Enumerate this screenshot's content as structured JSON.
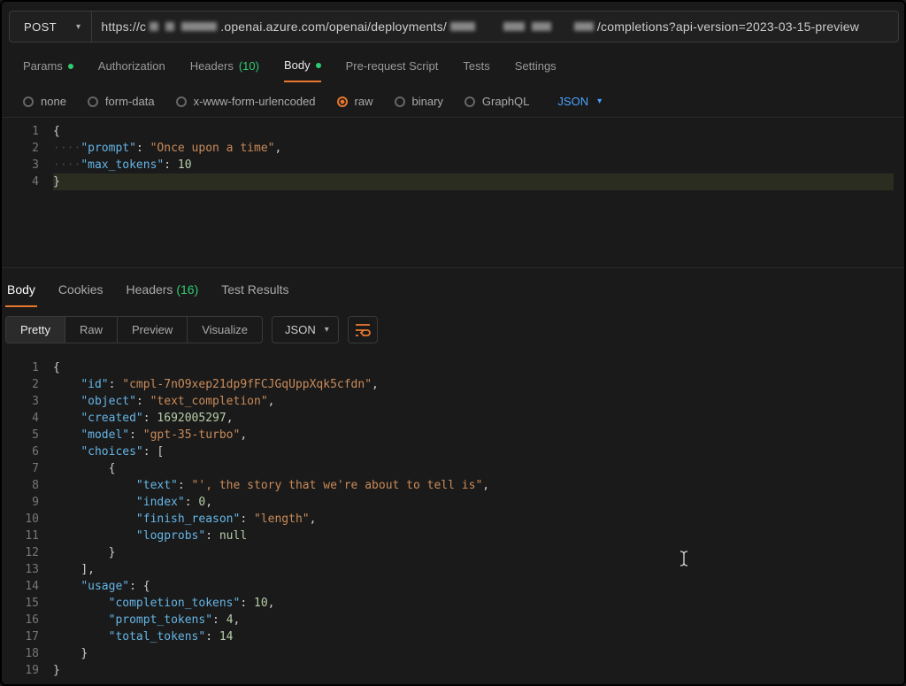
{
  "request": {
    "method": "POST",
    "url_prefix": "https://c",
    "url_mid": ".openai.azure.com/openai/deployments/",
    "url_suffix": "/completions?api-version=2023-03-15-preview"
  },
  "section_tabs": {
    "params": "Params",
    "authorization": "Authorization",
    "headers_label": "Headers",
    "headers_count": "(10)",
    "body": "Body",
    "prescript": "Pre-request Script",
    "tests": "Tests",
    "settings": "Settings"
  },
  "body_types": {
    "none": "none",
    "formdata": "form-data",
    "urlencoded": "x-www-form-urlencoded",
    "raw": "raw",
    "binary": "binary",
    "graphql": "GraphQL",
    "format": "JSON"
  },
  "request_body": {
    "line1": "{",
    "line2_key": "\"prompt\"",
    "line2_val": "\"Once upon a time\"",
    "line3_key": "\"max_tokens\"",
    "line3_val": "10",
    "line4": "}"
  },
  "response_tabs": {
    "body": "Body",
    "cookies": "Cookies",
    "headers_label": "Headers",
    "headers_count": "(16)",
    "testresults": "Test Results"
  },
  "response_toolbar": {
    "pretty": "Pretty",
    "raw": "Raw",
    "preview": "Preview",
    "visualize": "Visualize",
    "format": "JSON"
  },
  "response_body": {
    "l1": "{",
    "l2_k": "\"id\"",
    "l2_v": "\"cmpl-7nO9xep21dp9fFCJGqUppXqk5cfdn\"",
    "l3_k": "\"object\"",
    "l3_v": "\"text_completion\"",
    "l4_k": "\"created\"",
    "l4_v": "1692005297",
    "l5_k": "\"model\"",
    "l5_v": "\"gpt-35-turbo\"",
    "l6_k": "\"choices\"",
    "l7": "{",
    "l8_k": "\"text\"",
    "l8_v": "\"', the story that we're about to tell is\"",
    "l9_k": "\"index\"",
    "l9_v": "0",
    "l10_k": "\"finish_reason\"",
    "l10_v": "\"length\"",
    "l11_k": "\"logprobs\"",
    "l11_v": "null",
    "l12": "}",
    "l13": "],",
    "l14_k": "\"usage\"",
    "l15_k": "\"completion_tokens\"",
    "l15_v": "10",
    "l16_k": "\"prompt_tokens\"",
    "l16_v": "4",
    "l17_k": "\"total_tokens\"",
    "l17_v": "14",
    "l18": "}",
    "l19": "}"
  }
}
